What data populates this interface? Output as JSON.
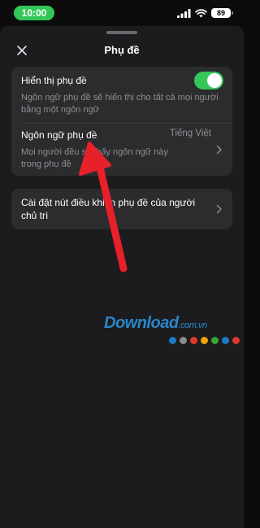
{
  "status_bar": {
    "time": "10:00",
    "battery": "89"
  },
  "sheet": {
    "title": "Phụ đề"
  },
  "settings": {
    "show_captions": {
      "title": "Hiển thị phụ đề",
      "description": "Ngôn ngữ phụ đề sẽ hiển thị cho tất cả mọi người bằng một ngôn ngữ",
      "enabled": true
    },
    "caption_language": {
      "title": "Ngôn ngữ phụ đề",
      "value": "Tiếng Việt",
      "description": "Mọi người đều sẽ thấy ngôn ngữ này trong phụ đề"
    },
    "host_caption_controls": {
      "title": "Cài đặt nút điều khiển phụ đề của người chủ trì"
    }
  },
  "watermark": {
    "brand": "Download",
    "suffix": ".com.vn",
    "dot_colors": [
      "#1f78c6",
      "#8c8c8c",
      "#e0392b",
      "#f2a100",
      "#3aa635",
      "#1f78c6",
      "#e0392b"
    ]
  },
  "colors": {
    "accent_green": "#34c759",
    "annotation_arrow": "#e8202a"
  },
  "icons": {
    "close": "close-icon",
    "chevron": "chevron-right-icon",
    "signal": "signal-icon",
    "wifi": "wifi-icon",
    "battery": "battery-icon"
  }
}
